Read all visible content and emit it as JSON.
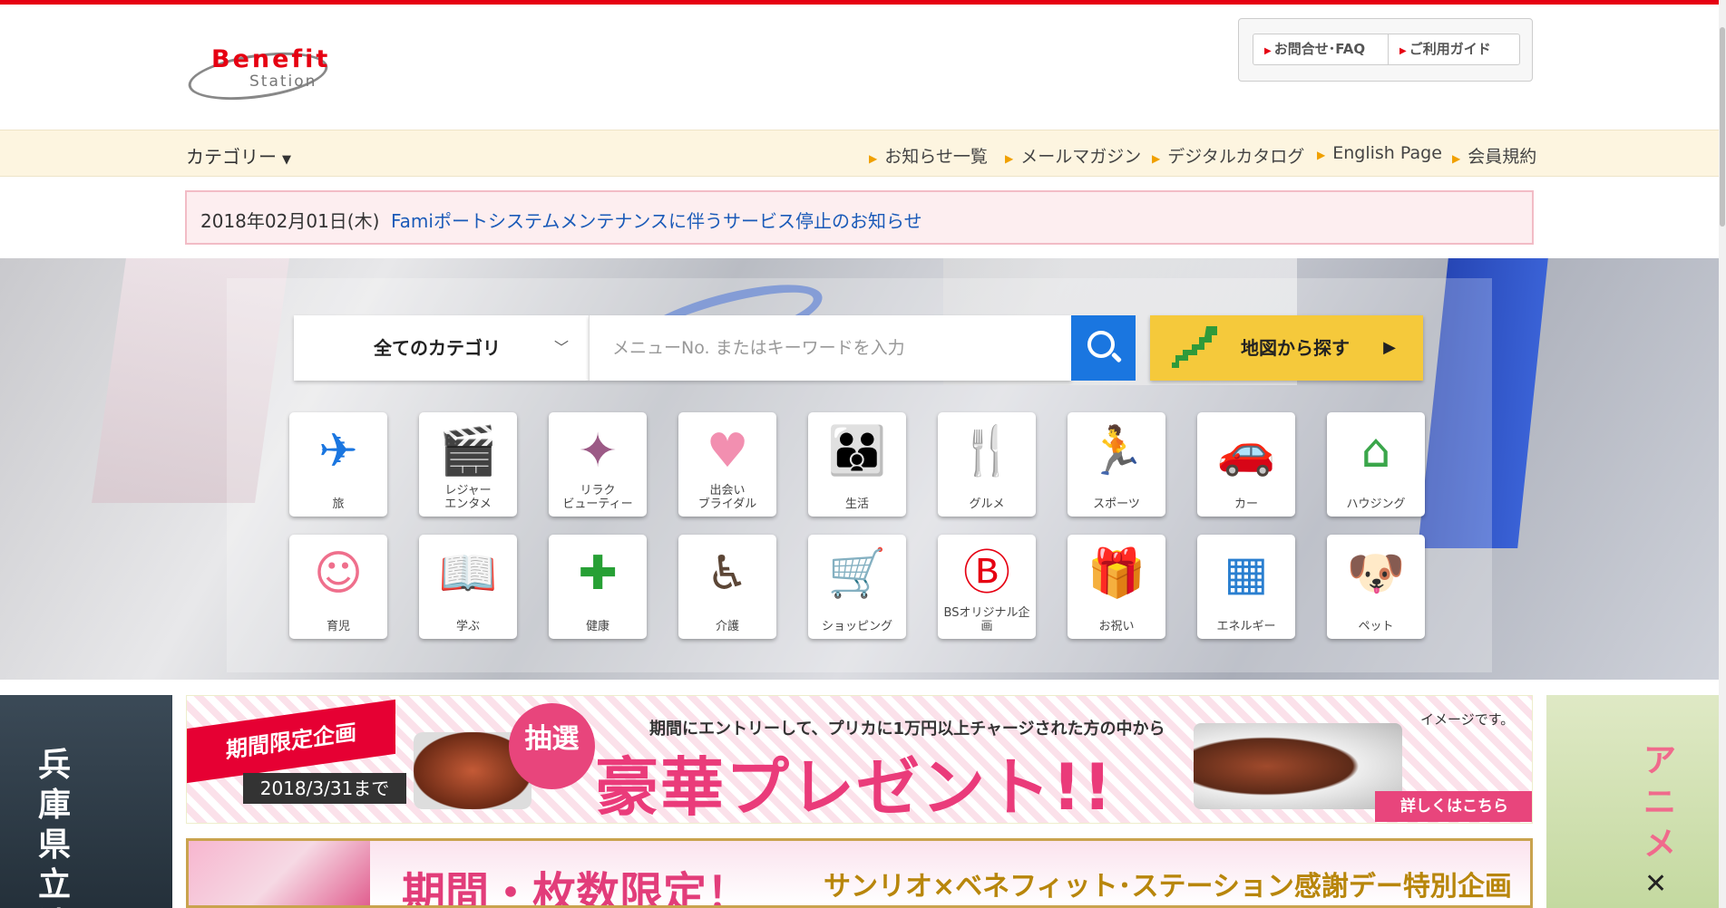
{
  "header": {
    "logo_main": "Benefit",
    "logo_sub": "Station",
    "help_links": [
      "お問合せ･FAQ",
      "ご利用ガイド"
    ]
  },
  "nav": {
    "category_label": "カテゴリー",
    "links": [
      "お知らせ一覧",
      "メールマガジン",
      "デジタルカタログ",
      "English Page",
      "会員規約"
    ]
  },
  "news": {
    "date": "2018年02月01日(木)",
    "title": "Famiポートシステムメンテナンスに伴うサービス停止のお知らせ"
  },
  "search": {
    "category_selected": "全てのカテゴリ",
    "placeholder": "メニューNo. またはキーワードを入力",
    "map_button": "地図から探す"
  },
  "categories": [
    {
      "label": "旅",
      "icon": "airplane-icon",
      "color": "#1a76e0"
    },
    {
      "label": "レジャー\nエンタメ",
      "icon": "clapperboard-icon",
      "color": "#f07a1e"
    },
    {
      "label": "リラク\nビューティー",
      "icon": "sparkle-icon",
      "color": "#9c5a86"
    },
    {
      "label": "出会い\nブライダル",
      "icon": "hearts-icon",
      "color": "#f28fb0"
    },
    {
      "label": "生活",
      "icon": "family-icon",
      "color": "#a8904a"
    },
    {
      "label": "グルメ",
      "icon": "fork-knife-icon",
      "color": "#e8282f"
    },
    {
      "label": "スポーツ",
      "icon": "runner-icon",
      "color": "#1a5ab8"
    },
    {
      "label": "カー",
      "icon": "car-icon",
      "color": "#2a5f8a"
    },
    {
      "label": "ハウジング",
      "icon": "house-icon",
      "color": "#3aa64a"
    },
    {
      "label": "育児",
      "icon": "baby-face-icon",
      "color": "#ef6f8c"
    },
    {
      "label": "学ぶ",
      "icon": "book-icon",
      "color": "#2a4fa8"
    },
    {
      "label": "健康",
      "icon": "plus-cross-icon",
      "color": "#27a035"
    },
    {
      "label": "介護",
      "icon": "wheelchair-icon",
      "color": "#5c4636"
    },
    {
      "label": "ショッピング",
      "icon": "cart-icon",
      "color": "#f0a000"
    },
    {
      "label": "BSオリジナル企画",
      "icon": "bs-logo-icon",
      "color": "#e60012"
    },
    {
      "label": "お祝い",
      "icon": "gift-icon",
      "color": "#e60033"
    },
    {
      "label": "エネルギー",
      "icon": "solar-panel-icon",
      "color": "#2a7fd0"
    },
    {
      "label": "ペット",
      "icon": "dog-icon",
      "color": "#f0a000"
    }
  ],
  "banners": {
    "left_ad_text": "兵庫県立淡",
    "right_ad_text": "アニメ",
    "promo1": {
      "tag": "期間限定企画",
      "until": "2018/3/31まで",
      "lottery": "抽選",
      "line1": "期間にエントリーして、プリカに1万円以上チャージされた方の中から",
      "headline": "豪華プレゼント!!",
      "note": "イメージです。",
      "cta": "詳しくはこちら"
    },
    "promo2": {
      "headline": "期間・枚数限定！",
      "sub": "サンリオ×ベネフィット･ステーション感謝デー特別企画"
    }
  }
}
